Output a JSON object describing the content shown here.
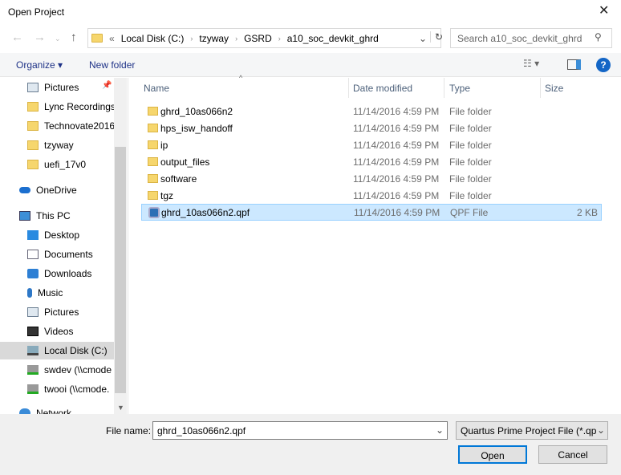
{
  "window": {
    "title": "Open Project"
  },
  "address": {
    "prefix": "«",
    "crumbs": [
      "Local Disk (C:)",
      "tzyway",
      "GSRD",
      "a10_soc_devkit_ghrd"
    ]
  },
  "search": {
    "placeholder": "Search a10_soc_devkit_ghrd"
  },
  "toolbar": {
    "organize": "Organize ▾",
    "new_folder": "New folder"
  },
  "sidebar": {
    "items": [
      {
        "label": "Pictures",
        "icon": "pictures-icon"
      },
      {
        "label": "Lync Recordings",
        "icon": "folder-icon"
      },
      {
        "label": "Technovate2016",
        "icon": "folder-icon"
      },
      {
        "label": "tzyway",
        "icon": "folder-icon"
      },
      {
        "label": "uefi_17v0",
        "icon": "folder-icon"
      },
      {
        "label": "OneDrive",
        "icon": "onedrive-icon"
      },
      {
        "label": "This PC",
        "icon": "computer-icon"
      },
      {
        "label": "Desktop",
        "icon": "desktop-icon"
      },
      {
        "label": "Documents",
        "icon": "documents-icon"
      },
      {
        "label": "Downloads",
        "icon": "downloads-icon"
      },
      {
        "label": "Music",
        "icon": "music-icon"
      },
      {
        "label": "Pictures",
        "icon": "pictures-icon"
      },
      {
        "label": "Videos",
        "icon": "videos-icon"
      },
      {
        "label": "Local Disk (C:)",
        "icon": "drive-icon"
      },
      {
        "label": "swdev (\\\\cmode",
        "icon": "network-drive-icon"
      },
      {
        "label": "twooi (\\\\cmode.",
        "icon": "network-drive-icon"
      },
      {
        "label": "Network",
        "icon": "network-icon"
      }
    ]
  },
  "columns": {
    "name": "Name",
    "date": "Date modified",
    "type": "Type",
    "size": "Size"
  },
  "files": [
    {
      "name": "ghrd_10as066n2",
      "date": "11/14/2016 4:59 PM",
      "type": "File folder",
      "size": ""
    },
    {
      "name": "hps_isw_handoff",
      "date": "11/14/2016 4:59 PM",
      "type": "File folder",
      "size": ""
    },
    {
      "name": "ip",
      "date": "11/14/2016 4:59 PM",
      "type": "File folder",
      "size": ""
    },
    {
      "name": "output_files",
      "date": "11/14/2016 4:59 PM",
      "type": "File folder",
      "size": ""
    },
    {
      "name": "software",
      "date": "11/14/2016 4:59 PM",
      "type": "File folder",
      "size": ""
    },
    {
      "name": "tgz",
      "date": "11/14/2016 4:59 PM",
      "type": "File folder",
      "size": ""
    },
    {
      "name": "ghrd_10as066n2.qpf",
      "date": "11/14/2016 4:59 PM",
      "type": "QPF File",
      "size": "2 KB"
    }
  ],
  "footer": {
    "file_name_label": "File name:",
    "file_name_value": "ghrd_10as066n2.qpf",
    "filter": "Quartus Prime Project File (*.qp",
    "open": "Open",
    "cancel": "Cancel"
  }
}
